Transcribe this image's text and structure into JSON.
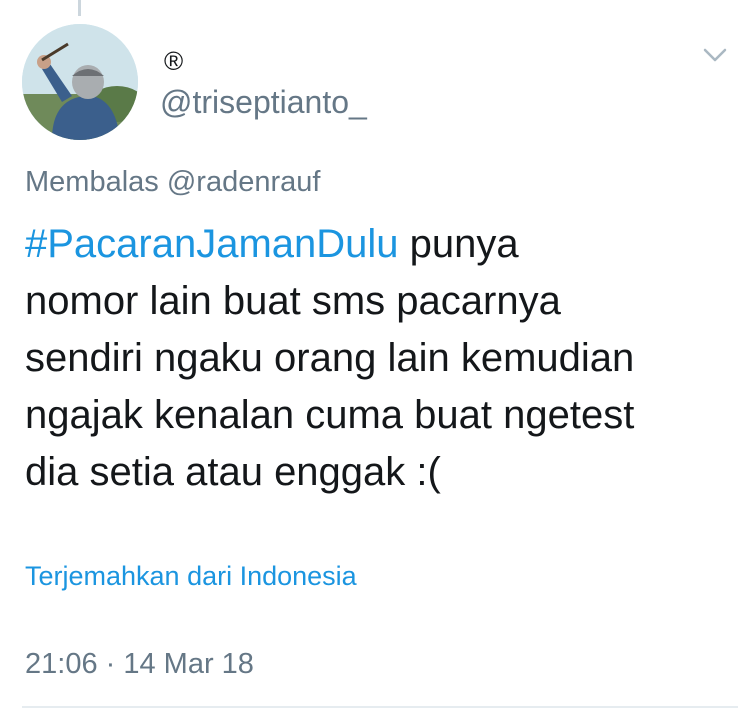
{
  "tweet": {
    "display_name_mark": "®",
    "handle": "@triseptianto_",
    "reply_prefix": "Membalas",
    "reply_mention": "@radenrauf",
    "hashtag": "#PacaranJamanDulu",
    "text_line1_rest": " punya",
    "text_line2": "nomor lain buat sms pacarnya",
    "text_line3": "sendiri ngaku orang lain kemudian",
    "text_line4": "ngajak kenalan cuma buat ngetest",
    "text_line5": "dia setia atau enggak :(",
    "translate_label": "Terjemahkan dari Indonesia",
    "timestamp": "21:06 · 14 Mar 18",
    "menu_icon": "chevron-down-icon",
    "avatar": "avatar-photo"
  },
  "colors": {
    "link": "#1b95e0",
    "secondary": "#657786",
    "text": "#14171a"
  }
}
